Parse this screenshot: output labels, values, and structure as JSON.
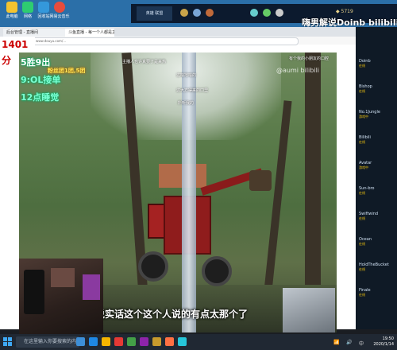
{
  "desktop": {
    "icons": [
      {
        "label": "此电脑",
        "color": "#f4c430"
      },
      {
        "label": "网络",
        "color": "#2ecc71"
      },
      {
        "label": "回收站",
        "color": "#3498db"
      },
      {
        "label": "网易云音乐",
        "color": "#e74c3c"
      }
    ]
  },
  "browser": {
    "tabs": [
      {
        "label": "后台管理 - 直播间"
      },
      {
        "label": "斗鱼直播 - 每一个人都是主角"
      }
    ],
    "url": "www.douyu.com/..."
  },
  "stream": {
    "score": "1401分",
    "overlay_lines": [
      "5胜9出",
      "9:OL接单",
      "12点睡觉"
    ],
    "overlay_small": "粉丝团1团,5团",
    "subtitle": "我说实话这个这个人说的有点太那个了",
    "danmaku": [
      "主播人也许真要了是来热",
      "这啥地啥的",
      "有个我的小朋友的口腔",
      "这大方得来的口里",
      "所听我的"
    ]
  },
  "game_window": {
    "tab_label": "英雄 联盟",
    "currency": "5719"
  },
  "watermarks": {
    "top": "嗨男解说Doinb bilibili",
    "mid": "@aumi bilibili"
  },
  "right_panel": {
    "items": [
      {
        "name": "Doinb",
        "status": "在线"
      },
      {
        "name": "Bishop",
        "status": "在线"
      },
      {
        "name": "No.1Jungle",
        "status": "游戏中"
      },
      {
        "name": "Bilibili",
        "status": "在线"
      },
      {
        "name": "Avatar",
        "status": "游戏中"
      },
      {
        "name": "Sun-bro",
        "status": "在线"
      },
      {
        "name": "Swiftwind",
        "status": "在线"
      },
      {
        "name": "Ocean",
        "status": "在线"
      },
      {
        "name": "HoldTheBucket",
        "status": "在线"
      },
      {
        "name": "Finale",
        "status": "在线"
      }
    ]
  },
  "taskbar": {
    "search_placeholder": "在这里输入你要搜索的内容",
    "time": "19:50",
    "date": "2020/1/14",
    "tray_text": "中"
  }
}
